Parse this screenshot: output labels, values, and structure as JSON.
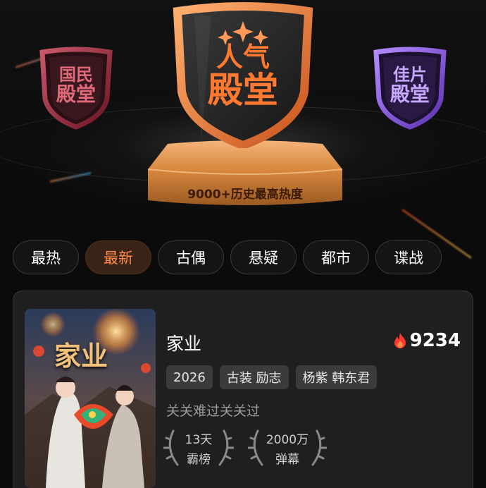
{
  "badges": {
    "left": {
      "line1": "国民",
      "line2": "殿堂"
    },
    "center": {
      "line1": "人气",
      "line2": "殿堂"
    },
    "right": {
      "line1": "佳片",
      "line2": "殿堂"
    }
  },
  "pedestal": {
    "label": "9000+历史最高热度"
  },
  "tabs": [
    {
      "label": "最热",
      "active": false
    },
    {
      "label": "最新",
      "active": true
    },
    {
      "label": "古偶",
      "active": false
    },
    {
      "label": "悬疑",
      "active": false
    },
    {
      "label": "都市",
      "active": false
    },
    {
      "label": "谍战",
      "active": false
    }
  ],
  "card": {
    "poster_title": "家业",
    "title": "家业",
    "heat_value": "9234",
    "tags": [
      "2026",
      "古装 励志",
      "杨紫 韩东君"
    ],
    "description": "关关难过关关过",
    "awards": [
      {
        "line1": "13天",
        "line2": "霸榜"
      },
      {
        "line1": "2000万",
        "line2": "弹幕"
      }
    ]
  },
  "colors": {
    "accent": "#ff8a4a",
    "heat_icon": "#ff3b2f",
    "active_tab_bg": "#3a2418"
  },
  "icons": {
    "heat": "flame-icon",
    "award_wreath": "laurel-icon"
  }
}
